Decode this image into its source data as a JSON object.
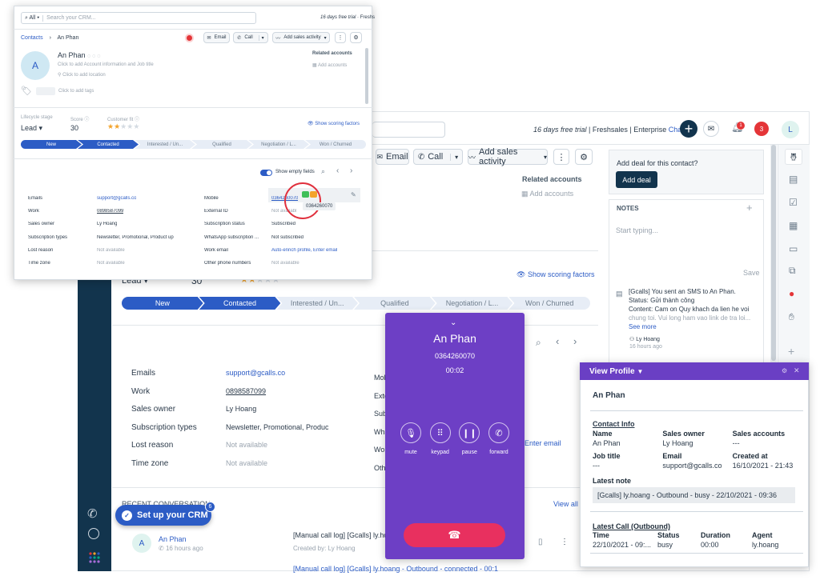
{
  "back": {
    "trial_text": "16 days free trial",
    "plan_text": "Freshsales | Enterprise",
    "change_link": "Change",
    "notif_count": "3",
    "notif_badge": "1",
    "avatar_letter": "L",
    "email_btn": "Email",
    "call_btn": "Call",
    "add_activity_btn": "Add sales activity",
    "related_accounts_title": "Related accounts",
    "add_accounts": "Add accounts",
    "lifecycle_value": "Lead",
    "score_value": "30",
    "show_scoring": "Show scoring factors",
    "stages": [
      "New",
      "Contacted",
      "Interested / Un...",
      "Qualified",
      "Negotiation / L...",
      "Won / Churned"
    ],
    "fields": [
      {
        "label": "Emails",
        "value": "support@gcalls.co",
        "type": "link"
      },
      {
        "label": "Work",
        "value": "0898587099",
        "type": "underline"
      },
      {
        "label": "Sales owner",
        "value": "Ly Hoang",
        "type": "text"
      },
      {
        "label": "Subscription types",
        "value": "Newsletter, Promotional, Product up",
        "type": "text"
      },
      {
        "label": "Lost reason",
        "value": "Not available",
        "type": "muted"
      },
      {
        "label": "Time zone",
        "value": "Not available",
        "type": "muted"
      }
    ],
    "right_labels": [
      "Mob",
      "Exte",
      "Sub",
      "Wha",
      "Wor",
      "Oth"
    ],
    "enter_email": "Enter email",
    "recent_conv_title": "RECENT CONVERSATION",
    "view_all": "View all",
    "conv_name": "An Phan",
    "conv_avatar": "A",
    "conv_time": "16 hours ago",
    "conv_text_1": "[Manual call log] [Gcalls] ly.hoa",
    "conv_created": "Created by: Ly Hoang",
    "conv_text_2": "[Manual call log] [Gcalls] ly.hoang - Outbound - connected - 00:1",
    "setup_crm": "Set up your CRM",
    "setup_badge": "6"
  },
  "deal_panel": {
    "prompt": "Add deal for this contact?",
    "add_deal_btn": "Add deal",
    "notes_title": "NOTES",
    "notes_placeholder": "Start typing...",
    "save_label": "Save",
    "note_line1": "[Gcalls] You sent an SMS to An Phan.",
    "note_line2": "Status: Gửi thành công",
    "note_line3": "Content: Cam on Quy khach da lien he voi",
    "note_line4": "chung toi. Vui long ham vao link de tra loi...",
    "see_more": "See more",
    "note_author": "Ly Hoang",
    "note_time": "16 hours ago"
  },
  "front": {
    "search_scope": "All",
    "search_placeholder": "Search your CRM...",
    "trial_text": "16 days free trial",
    "trial_brand": "Freshs",
    "breadcrumb_root": "Contacts",
    "breadcrumb_current": "An Phan",
    "email_btn": "Email",
    "call_btn": "Call",
    "add_activity_btn": "Add sales activity",
    "contact_name": "An Phan",
    "avatar_letter": "A",
    "add_account_info": "Click to add Account information and Job title",
    "add_location": "Click to add location",
    "add_tags": "Click to add tags",
    "related_accounts_title": "Related accounts",
    "add_accounts": "Add accounts",
    "lifecycle_label": "Lifecycle stage",
    "lifecycle_value": "Lead",
    "score_label": "Score",
    "score_value": "30",
    "fit_label": "Customer fit",
    "fit_stars": 2,
    "show_scoring": "Show scoring factors",
    "stages": [
      "New",
      "Contacted",
      "Interested / Un...",
      "Qualified",
      "Negotiation / L...",
      "Won / Churned"
    ],
    "show_empty_fields": "Show empty fields",
    "left_fields": [
      {
        "label": "Emails",
        "value": "support@gcalls.co",
        "type": "link"
      },
      {
        "label": "Work",
        "value": "0898587099",
        "type": "underline"
      },
      {
        "label": "Sales owner",
        "value": "Ly Hoang",
        "type": "text"
      },
      {
        "label": "Subscription types",
        "value": "Newsletter, Promotional, Product up",
        "type": "text"
      },
      {
        "label": "Lost reason",
        "value": "Not available",
        "type": "muted"
      },
      {
        "label": "Time zone",
        "value": "Not available",
        "type": "muted"
      }
    ],
    "right_fields": [
      {
        "label": "Mobile",
        "value": "0364260070",
        "type": "link"
      },
      {
        "label": "External ID",
        "value": "Not availabl",
        "type": "muted"
      },
      {
        "label": "Subscription status",
        "value": "Subscribed",
        "type": "text"
      },
      {
        "label": "WhatsApp subscription ...",
        "value": "Not subscribed",
        "type": "text"
      },
      {
        "label": "Work email",
        "value": "Auto-enrich profile, Enter email",
        "type": "link"
      },
      {
        "label": "Other phone numbers",
        "value": "Not available",
        "type": "muted"
      }
    ],
    "tooltip_number": "0364260070"
  },
  "call": {
    "name": "An Phan",
    "number": "0364260070",
    "timer": "00:02",
    "controls": [
      "mute",
      "keypad",
      "pause",
      "forward"
    ]
  },
  "profile": {
    "header": "View Profile",
    "name": "An Phan",
    "contact_info_title": "Contact Info",
    "labels": {
      "name": "Name",
      "sales_owner": "Sales owner",
      "sales_accounts": "Sales accounts",
      "job_title": "Job title",
      "email": "Email",
      "created_at": "Created at"
    },
    "values": {
      "name": "An Phan",
      "sales_owner": "Ly Hoang",
      "sales_accounts": "---",
      "job_title": "---",
      "email": "support@gcalls.co",
      "created_at": "16/10/2021 - 21:43"
    },
    "latest_note_title": "Latest note",
    "latest_note": "[Gcalls] ly.hoang - Outbound - busy - 22/10/2021 - 09:36",
    "latest_call_title": "Latest Call (Outbound)",
    "call_headers": [
      "Time",
      "Status",
      "Duration",
      "Agent"
    ],
    "call_values": [
      "22/10/2021 - 09:...",
      "busy",
      "00:00",
      "ly.hoang"
    ]
  },
  "colors": {
    "primary": "#2c5cc5",
    "navy": "#12344d",
    "call_purple": "#6d3fc5",
    "profile_header": "#6a3fc4",
    "hangup": "#e8305f",
    "notif_red": "#e43538"
  }
}
